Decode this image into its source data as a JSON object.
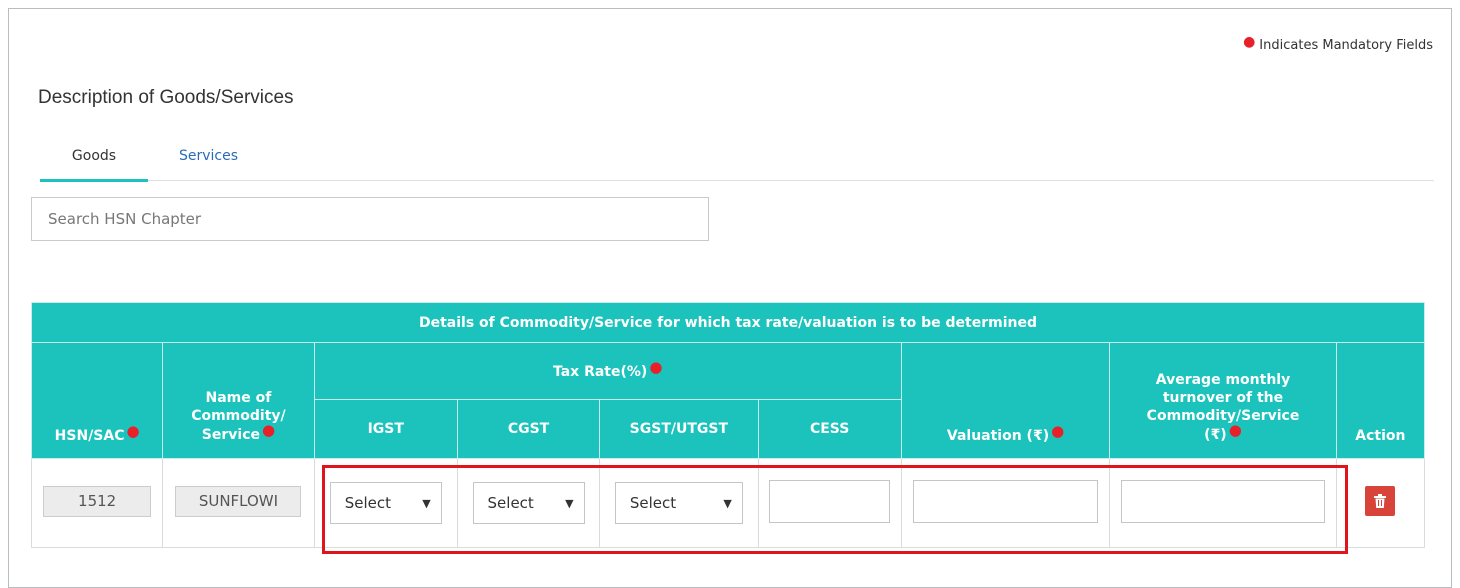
{
  "mandatory_note": "Indicates Mandatory Fields",
  "section_title": "Description of Goods/Services",
  "tabs": [
    {
      "label": "Goods",
      "active": true
    },
    {
      "label": "Services",
      "active": false
    }
  ],
  "search": {
    "placeholder": "Search HSN Chapter",
    "value": ""
  },
  "table": {
    "caption": "Details of Commodity/Service for which tax rate/valuation is to be determined",
    "headers": {
      "hsn": "HSN/SAC",
      "name_line1": "Name of",
      "name_line2": "Commodity/",
      "name_line3": "Service",
      "tax_rate": "Tax Rate(%)",
      "igst": "IGST",
      "cgst": "CGST",
      "sgst": "SGST/UTGST",
      "cess": "CESS",
      "valuation": "Valuation (₹)",
      "turnover_line1": "Average monthly",
      "turnover_line2": "turnover of the",
      "turnover_line3": "Commodity/Service",
      "turnover_line4": "(₹)",
      "action": "Action"
    },
    "row": {
      "hsn": "1512",
      "name": "SUNFLOWI",
      "igst": "Select",
      "cgst": "Select",
      "sgst": "Select",
      "cess": "",
      "valuation": "",
      "turnover": ""
    }
  },
  "icons": {
    "delete": "trash-icon",
    "dropdown": "dropdown-arrow-icon"
  },
  "colors": {
    "header_bg": "#1cc3bd",
    "required": "#e8202a",
    "delete_bg": "#d9443a",
    "highlight": "#e0141a",
    "tab_active": "#1bc3bc",
    "link": "#2b6cb5"
  }
}
